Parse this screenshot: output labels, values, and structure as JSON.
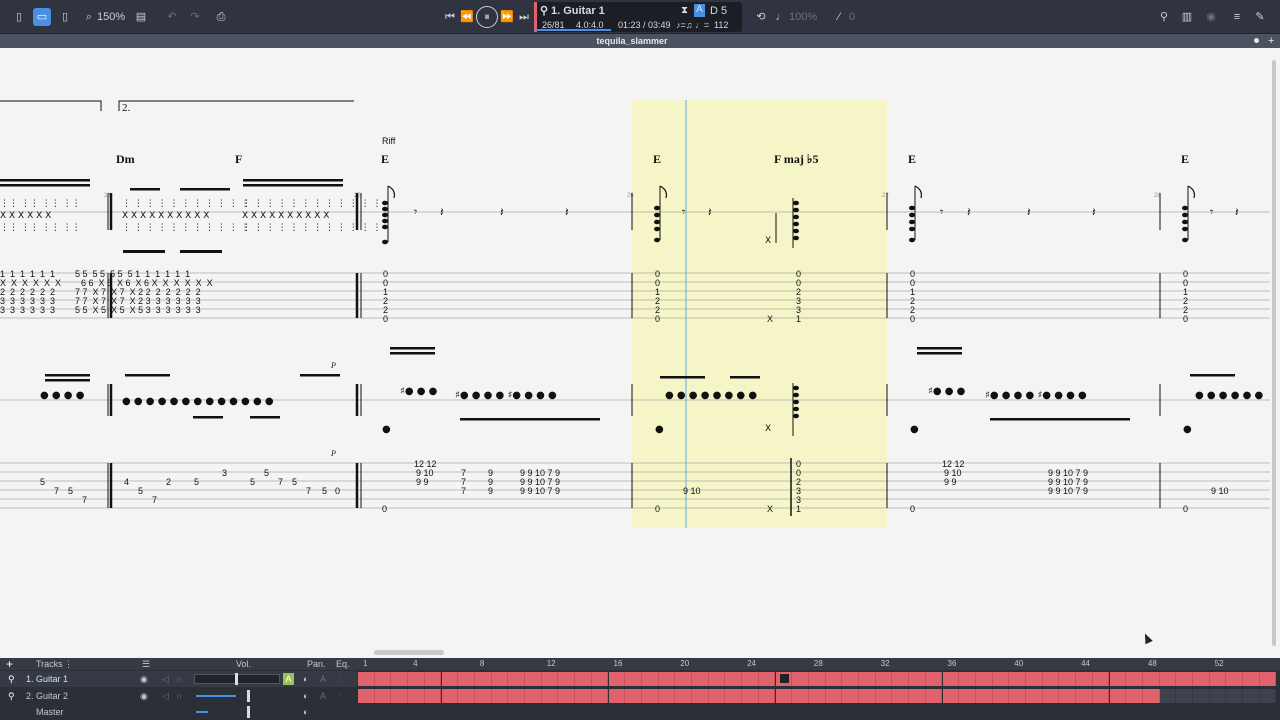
{
  "toolbar": {
    "zoom": "150%",
    "track_name": "1. Guitar 1",
    "bar_position": "26/81",
    "time_signature": "4.0:4.0",
    "time": "01:23 / 03:49",
    "tempo": "112",
    "key": "D 5",
    "speed": "100%",
    "pitch": "0"
  },
  "document": {
    "title": "tequila_slammer"
  },
  "score": {
    "volta_label": "2.",
    "section_label": "Riff",
    "chords": [
      "Dm",
      "F",
      "E",
      "E",
      "F maj ♭5",
      "E",
      "E"
    ],
    "bar_numbers": [
      "24",
      "25",
      "26",
      "27",
      "28"
    ],
    "dynamic_marks": [
      "P",
      "P"
    ],
    "tab1_rows": [
      "1  1  1  1  1  1        5 5  5 5  5 5  5 1  1  1  1  1  1",
      "X  X  X  X  X  X        6 6  X 6  X 6  X 6 X  X  X  X  X  X",
      "2  2  2  2  2  2        7 7  X 7  X 7  X 2 2  2  2  2  2  2",
      "3  3  3  3  3  3        7 7  X 7  X 7  X 2 3  3  3  3  3  3",
      "3  3  3  3  3  3        5 5  X 5  X 5  X 5 3  3  3  3  3  3"
    ],
    "tab1_chord_e": [
      "0",
      "0",
      "1",
      "2",
      "2",
      "0"
    ],
    "tab1_chord_f": [
      "0",
      "0",
      "2",
      "3",
      "3",
      "1"
    ],
    "tab2_left": [
      "5",
      "7",
      "5",
      "7",
      "4",
      "5",
      "7",
      "2",
      "5",
      "3",
      "5",
      "5",
      "7",
      "5",
      "7",
      "5",
      "0"
    ],
    "tab2_mid": [
      "12 12",
      "9 10",
      "9 9",
      "7",
      "7",
      "7",
      "9",
      "9",
      "9",
      "9 9 10 7 9",
      "9 9 10 7 9",
      "9 9 10 7 9"
    ],
    "tab2_open": "0",
    "tab2_x": "X"
  },
  "tracks_panel": {
    "header_label": "Tracks",
    "vol_label": "Vol.",
    "pan_label": "Pan.",
    "eq_label": "Eq.",
    "timeline_numbers": [
      "1",
      "4",
      "8",
      "12",
      "16",
      "20",
      "24",
      "28",
      "32",
      "36",
      "40",
      "44",
      "48",
      "52"
    ],
    "tracks": [
      {
        "name": "1. Guitar 1"
      },
      {
        "name": "2. Guitar 2"
      },
      {
        "name": "Master"
      }
    ]
  },
  "colors": {
    "accent": "#4a90e2",
    "selection": "#f5f5c8",
    "clip": "#e0626d",
    "toolbar_bg": "#2f3440"
  }
}
